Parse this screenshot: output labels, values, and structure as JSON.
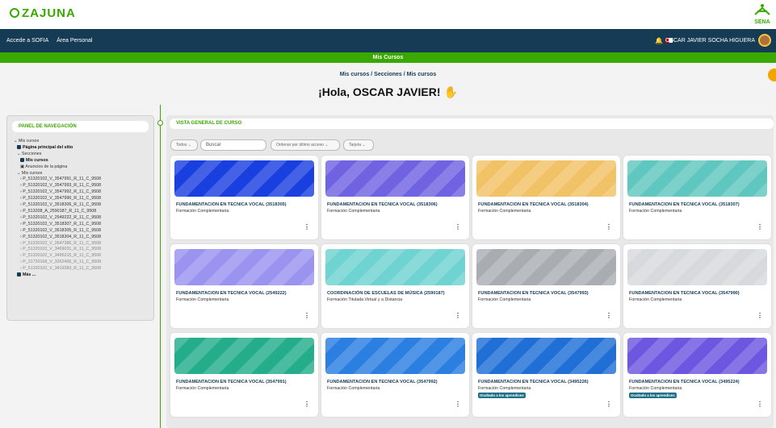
{
  "brand": {
    "logo": "ZAJUNA",
    "sena_logo": "SENA"
  },
  "navbar": {
    "links": [
      "Accede a SOFIA",
      "Área Personal"
    ],
    "user_name": "OSCAR JAVIER SOCHA HIGUERA"
  },
  "page_banner": "Mis Cursos",
  "breadcrumb": "Mis cursos / Secciones / Mis cursos",
  "greeting": "¡Hola, OSCAR JAVIER!",
  "nav_panel": {
    "title": "PANEL DE NAVEGACIÓN",
    "items": [
      "Mis cursos",
      "Página principal del sitio",
      "Secciones",
      "Mis cursos",
      "Anuncios de la página",
      "Mis cursos",
      "P_51320102_V_3547991_R_11_C_9508",
      "P_51320102_V_3547993_R_11_C_9508",
      "P_51320102_V_3547992_R_11_C_9508",
      "P_51320102_V_3547990_R_11_C_9508",
      "P_51320102_V_3518306_R_11_C_9508",
      "P_513208_A_2590187_R_11_C_9508",
      "P_51320102_V_2549222_R_11_C_9508",
      "P_51320102_V_3518307_R_11_C_9508",
      "P_51320102_V_3518305_R_11_C_9508",
      "P_51320102_V_3518304_R_11_C_9508",
      "P_51320102_V_2647386_R_11_C_9508",
      "P_51320102_V_3469031_R_11_C_9508",
      "P_51320102_V_3495215_R_11_C_9508",
      "P_21720168_V_3262406_R_11_C_9508",
      "P_51320102_V_3419283_R_11_C_9508",
      "Más ..."
    ]
  },
  "overview": {
    "title": "VISTA GENERAL DE CURSO",
    "filter_label": "Todos",
    "search_placeholder": "Buscar",
    "sort_label": "Ordenar por último acceso",
    "view_label": "Tarjeta",
    "courses": [
      {
        "name": "FUNDAMENTACION EN TECNICA VOCAL (3518305)",
        "type": "Formación Complementaria",
        "badge": "",
        "color": "#1a3fe0"
      },
      {
        "name": "FUNDAMENTACION EN TECNICA VOCAL (3518306)",
        "type": "Formación Complementaria",
        "badge": "",
        "color": "#6f63e2"
      },
      {
        "name": "FUNDAMENTACION EN TECNICA VOCAL (3518304)",
        "type": "Formación Complementaria",
        "badge": "",
        "color": "#f2c266"
      },
      {
        "name": "FUNDAMENTACION EN TECNICA VOCAL (3518307)",
        "type": "Formación Complementaria",
        "badge": "",
        "color": "#5fc7bf"
      },
      {
        "name": "FUNDAMENTACION EN TECNICA VOCAL (2549222)",
        "type": "Formación Complementaria",
        "badge": "",
        "color": "#9b93f0"
      },
      {
        "name": "COORDINACIÓN DE ESCUELAS DE MÚSICA (2590187)",
        "type": "Formación Titulada Virtual y a Distancia",
        "badge": "",
        "color": "#6ed3d1"
      },
      {
        "name": "FUNDAMENTACION EN TECNICA VOCAL (3547993)",
        "type": "Formación Complementaria",
        "badge": "",
        "color": "#a9adb2"
      },
      {
        "name": "FUNDAMENTACION EN TECNICA VOCAL (3547990)",
        "type": "Formación Complementaria",
        "badge": "",
        "color": "#d7d9dc"
      },
      {
        "name": "FUNDAMENTACION EN TECNICA VOCAL (3547991)",
        "type": "Formación Complementaria",
        "badge": "",
        "color": "#23ad8a"
      },
      {
        "name": "FUNDAMENTACION EN TECNICA VOCAL (3547992)",
        "type": "Formación Complementaria",
        "badge": "",
        "color": "#2b7fe0"
      },
      {
        "name": "FUNDAMENTACION EN TECNICA VOCAL (3495226)",
        "type": "Formación Complementaria",
        "badge": "Ocultado a los aprendices",
        "color": "#1f6fd6"
      },
      {
        "name": "FUNDAMENTACION EN TECNICA VOCAL (3495224)",
        "type": "Formación Complementaria",
        "badge": "Ocultado a los aprendices",
        "color": "#6d57e0"
      }
    ]
  }
}
